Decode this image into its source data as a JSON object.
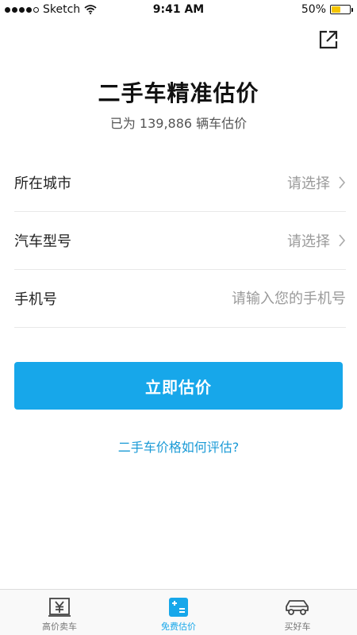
{
  "status_bar": {
    "carrier": "Sketch",
    "time": "9:41 AM",
    "battery_text": "50%",
    "battery_level": 0.5,
    "battery_color": "#f5c400"
  },
  "header": {
    "share_icon": "share-icon",
    "title": "二手车精准估价",
    "subtitle": "已为 139,886 辆车估价"
  },
  "form": {
    "city": {
      "label": "所在城市",
      "value": "请选择"
    },
    "model": {
      "label": "汽车型号",
      "value": "请选择"
    },
    "phone": {
      "label": "手机号",
      "placeholder": "请输入您的手机号"
    }
  },
  "actions": {
    "primary_label": "立即估价",
    "help_link": "二手车价格如何评估?"
  },
  "tab_bar": {
    "active_color": "#17a7ea",
    "tabs": [
      {
        "label": "高价卖车",
        "icon": "yuan-icon",
        "active": false
      },
      {
        "label": "免费估价",
        "icon": "calculator-icon",
        "active": true
      },
      {
        "label": "买好车",
        "icon": "car-icon",
        "active": false
      }
    ]
  }
}
